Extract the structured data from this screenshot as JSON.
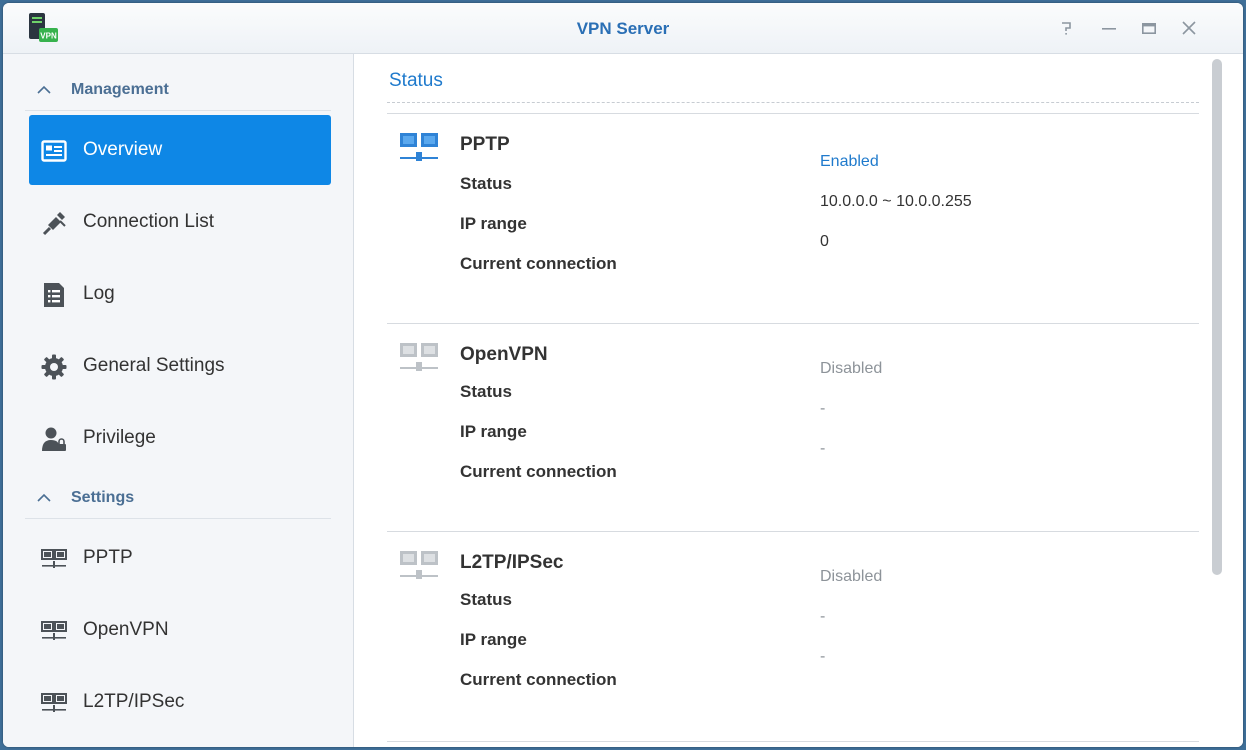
{
  "window": {
    "title": "VPN Server",
    "app_icon_text": "VPN"
  },
  "sidebar": {
    "management_label": "Management",
    "items": [
      {
        "label": "Overview",
        "icon": "overview-icon"
      },
      {
        "label": "Connection List",
        "icon": "connection-list-icon"
      },
      {
        "label": "Log",
        "icon": "log-icon"
      },
      {
        "label": "General Settings",
        "icon": "gear-icon"
      },
      {
        "label": "Privilege",
        "icon": "privilege-icon"
      }
    ],
    "settings_label": "Settings",
    "settings_items": [
      {
        "label": "PPTP",
        "icon": "network-icon"
      },
      {
        "label": "OpenVPN",
        "icon": "network-icon"
      },
      {
        "label": "L2TP/IPSec",
        "icon": "network-icon"
      }
    ]
  },
  "main": {
    "section_title": "Status",
    "blocks": [
      {
        "name": "PPTP",
        "status_label": "Status",
        "ip_label": "IP range",
        "conn_label": "Current connection",
        "status": "Enabled",
        "ip_range": "10.0.0.0 ~ 10.0.0.255",
        "connections": "0"
      },
      {
        "name": "OpenVPN",
        "status_label": "Status",
        "ip_label": "IP range",
        "conn_label": "Current connection",
        "status": "Disabled",
        "ip_range": "-",
        "connections": "-"
      },
      {
        "name": "L2TP/IPSec",
        "status_label": "Status",
        "ip_label": "IP range",
        "conn_label": "Current connection",
        "status": "Disabled",
        "ip_range": "-",
        "connections": "-"
      }
    ]
  },
  "colors": {
    "accent": "#0e87e6",
    "link": "#1f7acc",
    "disabled": "#8d9399"
  }
}
